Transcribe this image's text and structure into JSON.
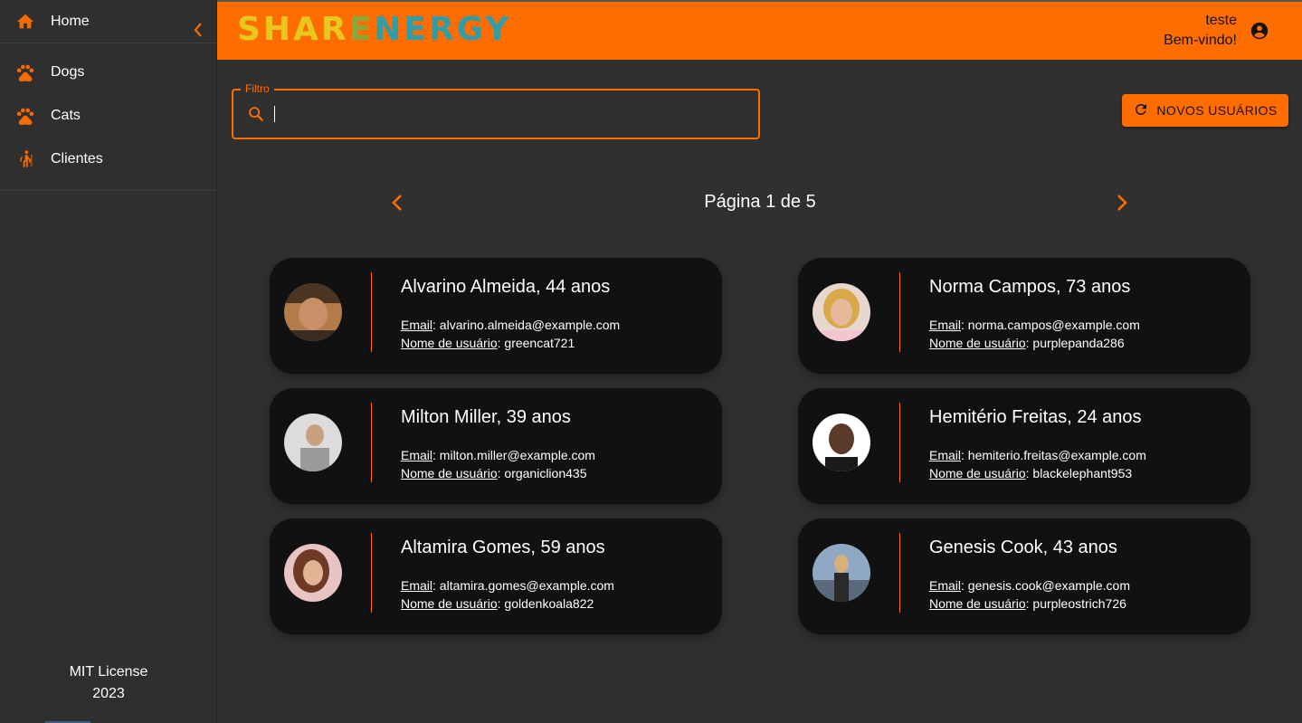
{
  "sidebar": {
    "home_label": "Home",
    "items": [
      {
        "label": "Dogs",
        "icon": "paw-icon"
      },
      {
        "label": "Cats",
        "icon": "paw-icon"
      },
      {
        "label": "Clientes",
        "icon": "person-cane-icon"
      }
    ],
    "footer_line1": "MIT License",
    "footer_line2": "2023"
  },
  "header": {
    "logo_part1": "SHAR",
    "logo_part2": "E",
    "logo_part3": "NERGY",
    "user_name": "teste",
    "welcome": "Bem-vindo!"
  },
  "filter": {
    "label": "Filtro",
    "value": ""
  },
  "actions": {
    "new_users": "NOVOS USUÁRIOS"
  },
  "pagination": {
    "text": "Página 1 de 5"
  },
  "labels": {
    "email": "Email",
    "username": "Nome de usuário"
  },
  "users": [
    {
      "title": "Alvarino Almeida, 44 anos",
      "email": "alvarino.almeida@example.com",
      "username": "greencat721"
    },
    {
      "title": "Norma Campos, 73 anos",
      "email": "norma.campos@example.com",
      "username": "purplepanda286"
    },
    {
      "title": "Milton Miller, 39 anos",
      "email": "milton.miller@example.com",
      "username": "organiclion435"
    },
    {
      "title": "Hemitério Freitas, 24 anos",
      "email": "hemiterio.freitas@example.com",
      "username": "blackelephant953"
    },
    {
      "title": "Altamira Gomes, 59 anos",
      "email": "altamira.gomes@example.com",
      "username": "goldenkoala822"
    },
    {
      "title": "Genesis Cook, 43 anos",
      "email": "genesis.cook@example.com",
      "username": "purpleostrich726"
    }
  ],
  "colors": {
    "accent": "#ff6d00",
    "background": "#303030",
    "card": "#111111"
  }
}
